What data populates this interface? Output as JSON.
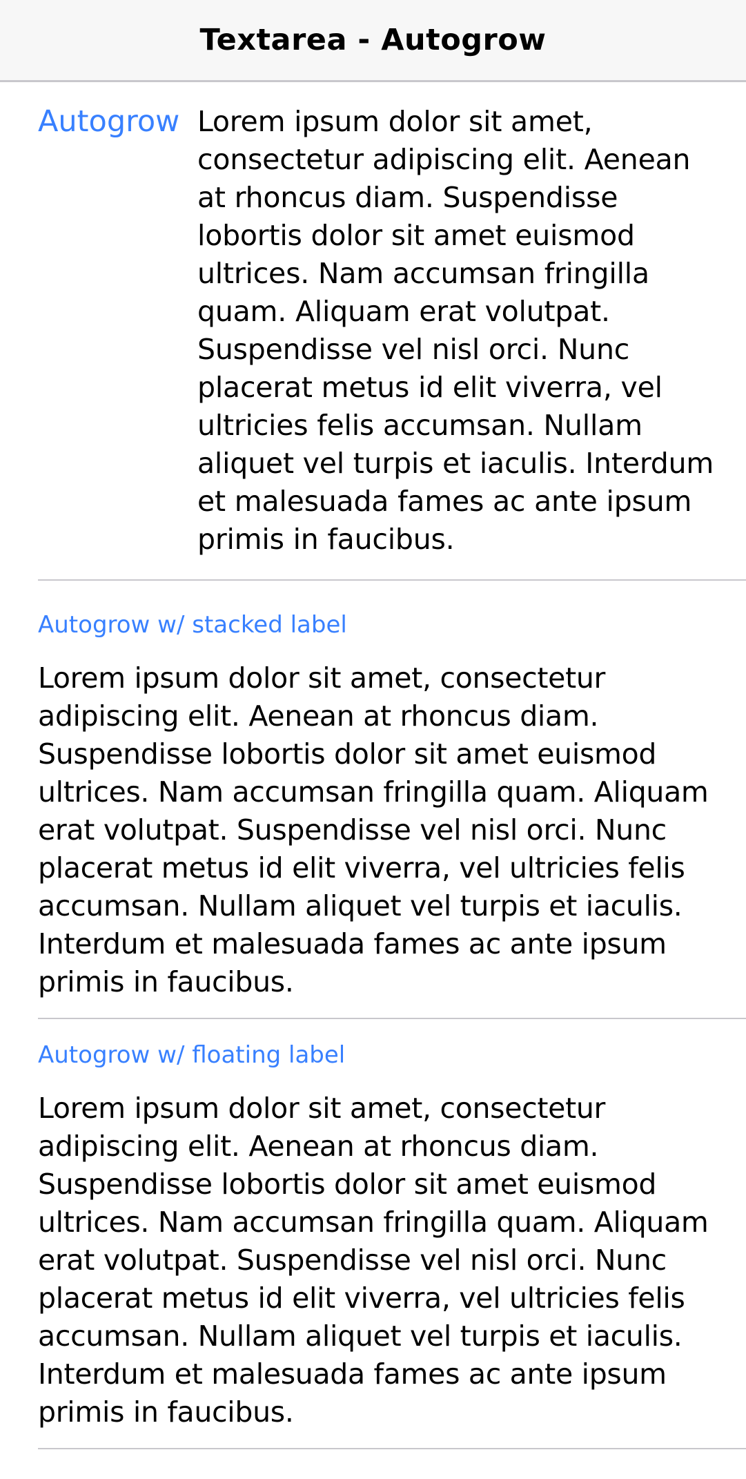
{
  "toolbar": {
    "title": "Textarea - Autogrow"
  },
  "items": [
    {
      "label": "Autogrow",
      "value": "Lorem ipsum dolor sit amet, consectetur adipiscing elit. Aenean at rhoncus diam. Suspendisse lobortis dolor sit amet euismod ultrices. Nam accumsan fringilla quam. Aliquam erat volutpat. Suspendisse vel nisl orci. Nunc placerat metus id elit viverra, vel ultricies felis accumsan. Nullam aliquet vel turpis et iaculis. Interdum et malesuada fames ac ante ipsum primis in faucibus."
    },
    {
      "label": "Autogrow w/ stacked label",
      "value": "Lorem ipsum dolor sit amet, consectetur adipiscing elit. Aenean at rhoncus diam. Suspendisse lobortis dolor sit amet euismod ultrices. Nam accumsan fringilla quam. Aliquam erat volutpat. Suspendisse vel nisl orci. Nunc placerat metus id elit viverra, vel ultricies felis accumsan. Nullam aliquet vel turpis et iaculis. Interdum et malesuada fames ac ante ipsum primis in faucibus."
    },
    {
      "label": "Autogrow w/ floating label",
      "value": "Lorem ipsum dolor sit amet, consectetur adipiscing elit. Aenean at rhoncus diam. Suspendisse lobortis dolor sit amet euismod ultrices. Nam accumsan fringilla quam. Aliquam erat volutpat. Suspendisse vel nisl orci. Nunc placerat metus id elit viverra, vel ultricies felis accumsan. Nullam aliquet vel turpis et iaculis. Interdum et malesuada fames ac ante ipsum primis in faucibus."
    }
  ],
  "colors": {
    "label": "#3880ff",
    "toolbar_background": "#f7f7f7",
    "divider": "#c8c7cc"
  }
}
